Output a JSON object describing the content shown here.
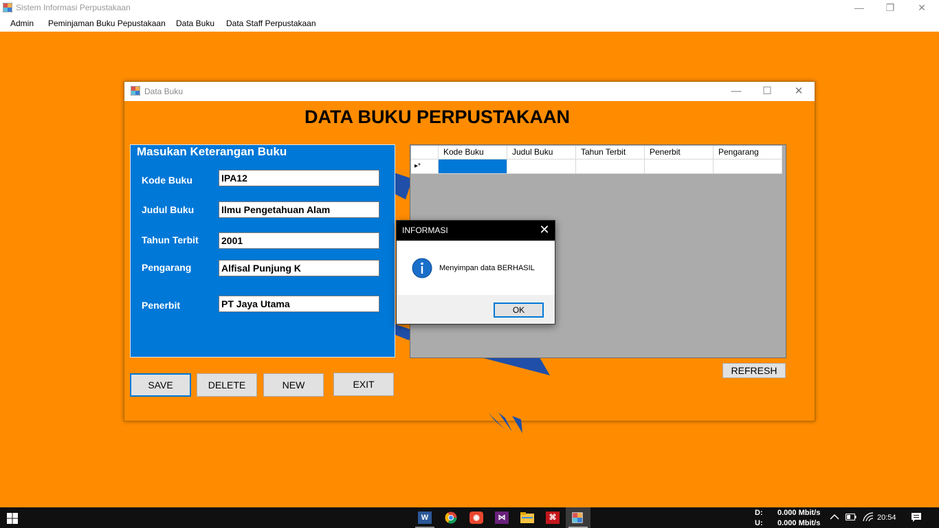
{
  "app": {
    "title": "Sistem Informasi Perpustakaan",
    "menu": [
      "Admin",
      "Peminjaman Buku Pepustakaan",
      "Data Buku",
      "Data Staff Perpustakaan"
    ]
  },
  "child_window": {
    "title": "Data Buku",
    "heading": "DATA BUKU PERPUSTAKAAN"
  },
  "form": {
    "group_title": "Masukan Keterangan Buku",
    "fields": [
      {
        "label": "Kode Buku",
        "value": "IPA12"
      },
      {
        "label": "Judul Buku",
        "value": "Ilmu Pengetahuan Alam"
      },
      {
        "label": "Tahun Terbit",
        "value": "2001"
      },
      {
        "label": "Pengarang",
        "value": "Alfisal Punjung K"
      },
      {
        "label": "Penerbit",
        "value": "PT Jaya Utama"
      }
    ]
  },
  "buttons": {
    "save": "SAVE",
    "delete": "DELETE",
    "new": "NEW",
    "exit": "EXIT",
    "refresh": "REFRESH"
  },
  "grid": {
    "columns": [
      "Kode Buku",
      "Judul Buku",
      "Tahun Terbit",
      "Penerbit",
      "Pengarang"
    ],
    "new_row_marker": "▸*"
  },
  "dialog": {
    "title": "INFORMASI",
    "message": "Menyimpan data BERHASIL",
    "ok": "OK"
  },
  "taskbar": {
    "net_down_label": "D:",
    "net_down": "0.000 Mbit/s",
    "net_up_label": "U:",
    "net_up": "0.000 Mbit/s",
    "time": "20:54",
    "apps": [
      "word-icon",
      "chrome-icon",
      "app-red-icon",
      "visual-studio-icon",
      "file-explorer-icon",
      "acrobat-icon",
      "winforms-app-icon"
    ]
  },
  "colors": {
    "background": "#ff8c00",
    "groupbox": "#0078d7",
    "grid": "#ababab",
    "accent": "#0078d7"
  }
}
